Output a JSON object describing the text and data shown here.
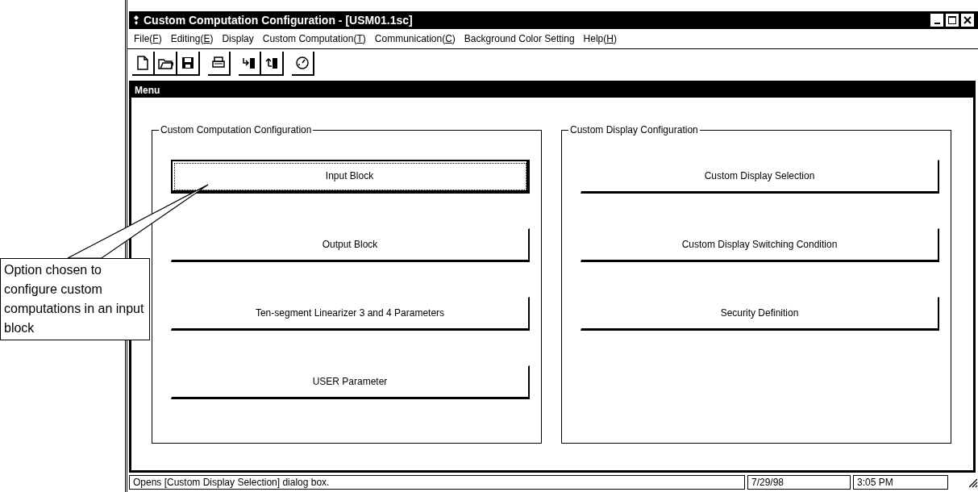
{
  "window": {
    "title": "Custom Computation Configuration - [USM01.1sc]"
  },
  "menu_bar": [
    {
      "text": "File(",
      "mnemonic": "F",
      "rest": ")"
    },
    {
      "text": "Editing(",
      "mnemonic": "E",
      "rest": ")"
    },
    {
      "text": "Display"
    },
    {
      "text": "Custom Computation(",
      "mnemonic": "T",
      "rest": ")"
    },
    {
      "text": "Communication(",
      "mnemonic": "C",
      "rest": ")"
    },
    {
      "text": "Background Color Setting"
    },
    {
      "text": "Help(",
      "mnemonic": "H",
      "rest": ")"
    }
  ],
  "panel": {
    "title": "Menu",
    "groups": [
      {
        "title": "Custom Computation Configuration",
        "buttons": [
          {
            "label": "Input Block",
            "selected": true
          },
          {
            "label": "Output Block",
            "selected": false
          },
          {
            "label": "Ten-segment Linearizer 3 and 4 Parameters",
            "selected": false
          },
          {
            "label": "USER Parameter",
            "selected": false
          }
        ]
      },
      {
        "title": "Custom Display Configuration",
        "buttons": [
          {
            "label": "Custom Display Selection",
            "selected": false
          },
          {
            "label": "Custom Display Switching Condition",
            "selected": false
          },
          {
            "label": "Security Definition",
            "selected": false
          }
        ]
      }
    ]
  },
  "callout": {
    "text": "Option chosen to configure custom computations in an input block"
  },
  "status_bar": {
    "message": "Opens [Custom Display Selection] dialog box.",
    "date": "7/29/98",
    "time": "3:05 PM"
  }
}
